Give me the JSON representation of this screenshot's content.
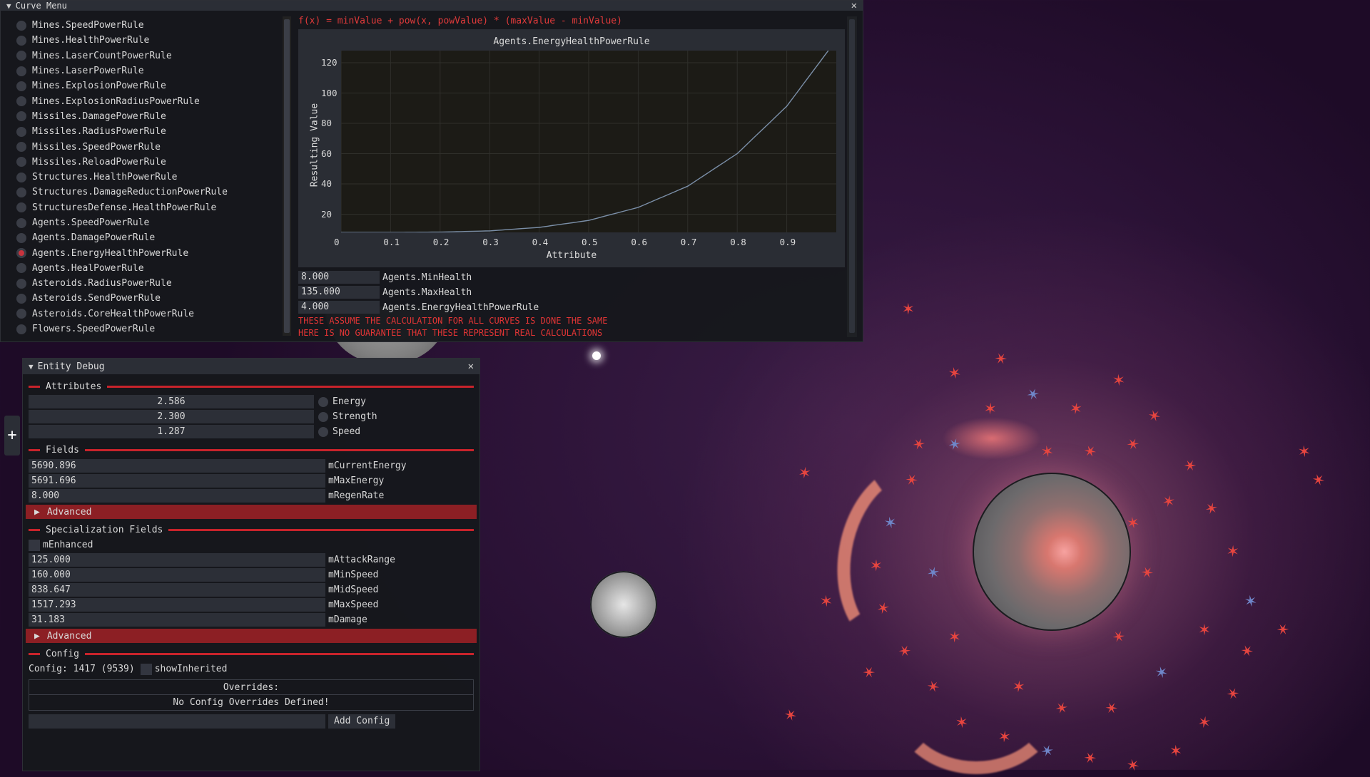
{
  "curve_menu": {
    "title": "Curve Menu",
    "formula": "f(x) = minValue + pow(x, powValue) * (maxValue - minValue)",
    "rules": [
      {
        "label": "Mines.SpeedPowerRule",
        "selected": false
      },
      {
        "label": "Mines.HealthPowerRule",
        "selected": false
      },
      {
        "label": "Mines.LaserCountPowerRule",
        "selected": false
      },
      {
        "label": "Mines.LaserPowerRule",
        "selected": false
      },
      {
        "label": "Mines.ExplosionPowerRule",
        "selected": false
      },
      {
        "label": "Mines.ExplosionRadiusPowerRule",
        "selected": false
      },
      {
        "label": "Missiles.DamagePowerRule",
        "selected": false
      },
      {
        "label": "Missiles.RadiusPowerRule",
        "selected": false
      },
      {
        "label": "Missiles.SpeedPowerRule",
        "selected": false
      },
      {
        "label": "Missiles.ReloadPowerRule",
        "selected": false
      },
      {
        "label": "Structures.HealthPowerRule",
        "selected": false
      },
      {
        "label": "Structures.DamageReductionPowerRule",
        "selected": false
      },
      {
        "label": "StructuresDefense.HealthPowerRule",
        "selected": false
      },
      {
        "label": "Agents.SpeedPowerRule",
        "selected": false
      },
      {
        "label": "Agents.DamagePowerRule",
        "selected": false
      },
      {
        "label": "Agents.EnergyHealthPowerRule",
        "selected": true
      },
      {
        "label": "Agents.HealPowerRule",
        "selected": false
      },
      {
        "label": "Asteroids.RadiusPowerRule",
        "selected": false
      },
      {
        "label": "Asteroids.SendPowerRule",
        "selected": false
      },
      {
        "label": "Asteroids.CoreHealthPowerRule",
        "selected": false
      },
      {
        "label": "Flowers.SpeedPowerRule",
        "selected": false
      }
    ],
    "params": [
      {
        "value": "8.000",
        "label": "Agents.MinHealth"
      },
      {
        "value": "135.000",
        "label": "Agents.MaxHealth"
      },
      {
        "value": "4.000",
        "label": "Agents.EnergyHealthPowerRule"
      }
    ],
    "warnings": [
      "THESE ASSUME THE CALCULATION FOR ALL CURVES IS DONE THE SAME",
      "HERE IS NO GUARANTEE THAT THESE REPRESENT REAL CALCULATIONS"
    ]
  },
  "chart_data": {
    "type": "line",
    "title": "Agents.EnergyHealthPowerRule",
    "xlabel": "Attribute",
    "ylabel": "Resulting Value",
    "xlim": [
      0,
      1
    ],
    "ylim": [
      8,
      128
    ],
    "xticks": [
      "0",
      "0.1",
      "0.2",
      "0.3",
      "0.4",
      "0.5",
      "0.6",
      "0.7",
      "0.8",
      "0.9"
    ],
    "yticks": [
      "20",
      "40",
      "60",
      "80",
      "100",
      "120"
    ],
    "grid": true,
    "series": [
      {
        "x": [
          0,
          0.1,
          0.2,
          0.3,
          0.4,
          0.5,
          0.6,
          0.7,
          0.8,
          0.9,
          1.0
        ],
        "y": [
          8,
          8.01,
          8.2,
          9.0,
          11.3,
          15.9,
          24.5,
          38.5,
          60.0,
          91.3,
          135
        ]
      }
    ],
    "line_color": "#7b8fa8"
  },
  "entity_debug": {
    "title": "Entity Debug",
    "sections": {
      "attributes": "Attributes",
      "fields": "Fields",
      "specialization": "Specialization Fields",
      "config": "Config"
    },
    "attributes": [
      {
        "value": "2.586",
        "label": "Energy"
      },
      {
        "value": "2.300",
        "label": "Strength"
      },
      {
        "value": "1.287",
        "label": "Speed"
      }
    ],
    "fields": [
      {
        "value": "5690.896",
        "label": "mCurrentEnergy"
      },
      {
        "value": "5691.696",
        "label": "mMaxEnergy"
      },
      {
        "value": "8.000",
        "label": "mRegenRate"
      }
    ],
    "advanced_label": "Advanced",
    "enhanced_label": "mEnhanced",
    "spec_fields": [
      {
        "value": "125.000",
        "label": "mAttackRange"
      },
      {
        "value": "160.000",
        "label": "mMinSpeed"
      },
      {
        "value": "838.647",
        "label": "mMidSpeed"
      },
      {
        "value": "1517.293",
        "label": "mMaxSpeed"
      },
      {
        "value": "31.183",
        "label": "mDamage"
      }
    ],
    "config_text": "Config: 1417 (9539)",
    "show_inherited": "showInherited",
    "overrides_header": "Overrides:",
    "overrides_empty": "No Config Overrides Defined!",
    "add_config": "Add Config",
    "add_config_value": ""
  },
  "side_tab_glyph": "+",
  "colors": {
    "accent_red": "#c8232b",
    "advanced_bg": "#8c1f24",
    "warning": "#e23535"
  }
}
